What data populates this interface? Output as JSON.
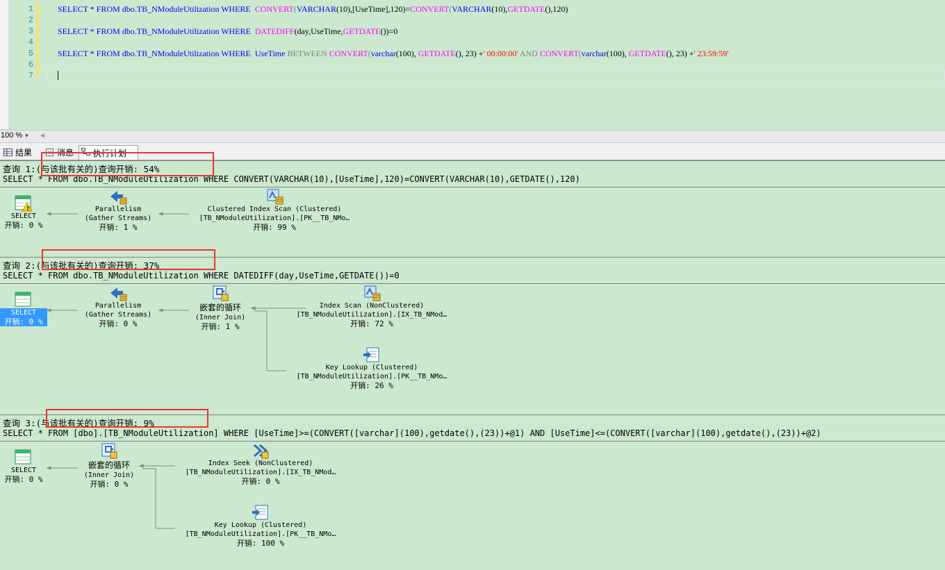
{
  "editor": {
    "lines": [
      "1",
      "2",
      "3",
      "4",
      "5",
      "6",
      "7"
    ],
    "line1": {
      "a": "SELECT * FROM dbo.TB_NModuleUtilization WHERE  ",
      "b": "CONVERT",
      "c": "(",
      "d": "VARCHAR",
      "e": "(10),[UseTime],120)=",
      "f": "CONVERT",
      "g": "(",
      "h": "VARCHAR",
      "i": "(10),",
      "j": "GETDATE",
      "k": "(),120)"
    },
    "line3": {
      "a": "SELECT * FROM dbo.TB_NModuleUtilization WHERE  ",
      "b": "DATEDIFF",
      "c": "(day,UseTime,",
      "d": "GETDATE",
      "e": "())=0"
    },
    "line5": {
      "a": "SELECT * FROM dbo.TB_NModuleUtilization WHERE  UseTime ",
      "b": "BETWEEN ",
      "c": "CONVERT",
      "d": "(",
      "e": "varchar",
      "f": "(100), ",
      "g": "GETDATE",
      "h": "(), 23) +",
      "i": "' 00:00:00'",
      "j": " AND ",
      "k": "CONVERT",
      "l": "(",
      "m": "varchar",
      "n": "(100), ",
      "o": "GETDATE",
      "p": "(), 23) +",
      "q": "' 23:59:59'"
    }
  },
  "zoom": {
    "value": "100 %"
  },
  "tabs": {
    "results": "结果",
    "messages": "消息",
    "plan": "执行计划"
  },
  "queries": [
    {
      "label": "查询 1:",
      "cost": "(与该批有关的)查询开销: 54%",
      "sql": "SELECT * FROM dbo.TB_NModuleUtilization WHERE CONVERT(VARCHAR(10),[UseTime],120)=CONVERT(VARCHAR(10),GETDATE(),120)",
      "nodes": {
        "select": {
          "name": "SELECT",
          "cost": "开销: 0 %"
        },
        "parallelism": {
          "name": "Parallelism",
          "sub": "(Gather Streams)",
          "cost": "开销: 1 %"
        },
        "scan": {
          "name": "Clustered Index Scan (Clustered)",
          "sub": "[TB_NModuleUtilization].[PK__TB_NMo…",
          "cost": "开销: 99 %"
        }
      }
    },
    {
      "label": "查询 2:",
      "cost": "(与该批有关的)查询开销: 37%",
      "sql": "SELECT * FROM dbo.TB_NModuleUtilization WHERE DATEDIFF(day,UseTime,GETDATE())=0",
      "nodes": {
        "select": {
          "name": "SELECT",
          "cost": "开销: 0 %"
        },
        "parallelism": {
          "name": "Parallelism",
          "sub": "(Gather Streams)",
          "cost": "开销: 0 %"
        },
        "loop": {
          "name": "嵌套的循环",
          "sub": "(Inner Join)",
          "cost": "开销: 1 %"
        },
        "scan": {
          "name": "Index Scan (NonClustered)",
          "sub": "[TB_NModuleUtilization].[IX_TB_NMod…",
          "cost": "开销: 72 %"
        },
        "lookup": {
          "name": "Key Lookup (Clustered)",
          "sub": "[TB_NModuleUtilization].[PK__TB_NMo…",
          "cost": "开销: 26 %"
        }
      }
    },
    {
      "label": "查询 3:",
      "cost": "(与该批有关的)查询开销: 9%",
      "sql": "SELECT * FROM [dbo].[TB_NModuleUtilization] WHERE [UseTime]>=(CONVERT([varchar](100),getdate(),(23))+@1) AND [UseTime]<=(CONVERT([varchar](100),getdate(),(23))+@2)",
      "nodes": {
        "select": {
          "name": "SELECT",
          "cost": "开销: 0 %"
        },
        "loop": {
          "name": "嵌套的循环",
          "sub": "(Inner Join)",
          "cost": "开销: 0 %"
        },
        "seek": {
          "name": "Index Seek (NonClustered)",
          "sub": "[TB_NModuleUtilization].[IX_TB_NMod…",
          "cost": "开销: 0 %"
        },
        "lookup": {
          "name": "Key Lookup (Clustered)",
          "sub": "[TB_NModuleUtilization].[PK__TB_NMo…",
          "cost": "开销: 100 %"
        }
      }
    }
  ],
  "colors": {
    "background": "#cce8cf",
    "keyword": "#0000ff",
    "function": "#ff00ff",
    "string": "#ff0000",
    "highlight": "#e8352f",
    "selection": "#3399ff"
  }
}
